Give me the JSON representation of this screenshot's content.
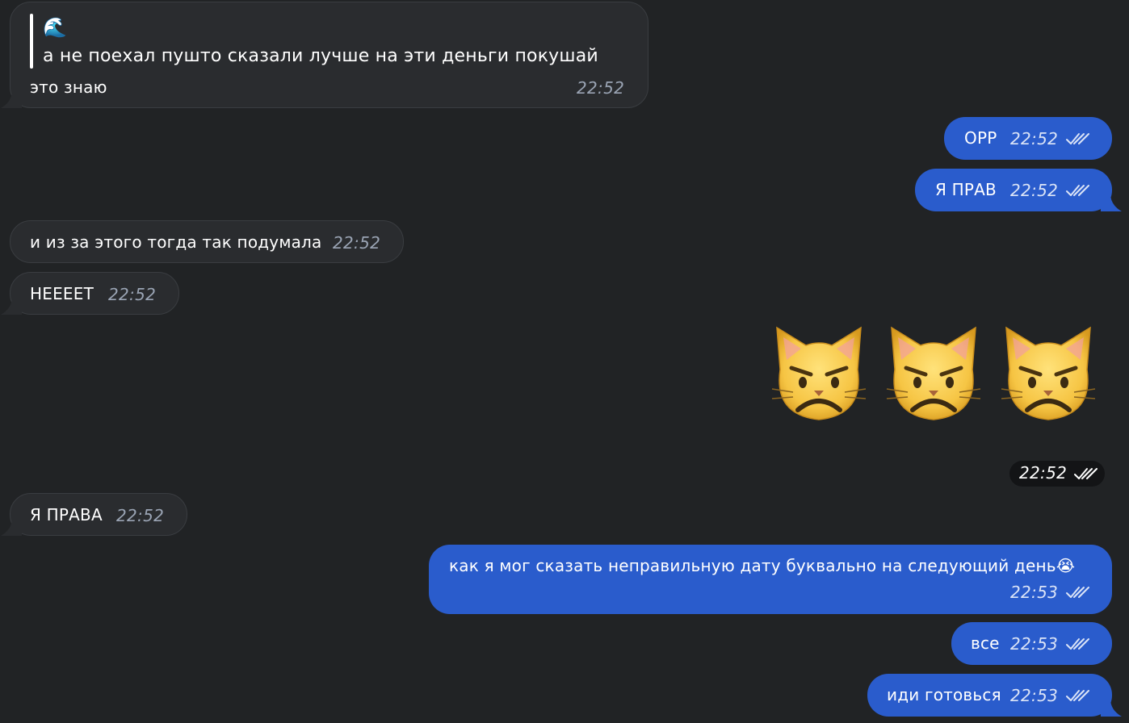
{
  "messages": {
    "m1": {
      "quote_emoji": "🌊",
      "quote_text": "а не поехал пушто сказали лучше на эти деньги покушай",
      "text": "это знаю",
      "time": "22:52"
    },
    "m2": {
      "text": "ОРР",
      "time": "22:52"
    },
    "m3": {
      "text": "Я ПРАВ",
      "time": "22:52"
    },
    "m4": {
      "text": "и из за этого тогда так подумала",
      "time": "22:52"
    },
    "m5": {
      "text": "НЕЕЕЕТ",
      "time": "22:52"
    },
    "m6": {
      "emoji": [
        "pouting-cat",
        "pouting-cat",
        "pouting-cat"
      ],
      "time": "22:52"
    },
    "m7": {
      "text": "Я ПРАВА",
      "time": "22:52"
    },
    "m8": {
      "text": "как я мог сказать неправильную дату буквально на следующий день😭",
      "time": "22:53"
    },
    "m9": {
      "text": "все",
      "time": "22:53"
    },
    "m10": {
      "text": "иди готовься",
      "time": "22:53"
    }
  },
  "colors": {
    "background": "#212325",
    "incoming_bubble": "#2a2c2f",
    "outgoing_bubble": "#2a5ccc"
  }
}
